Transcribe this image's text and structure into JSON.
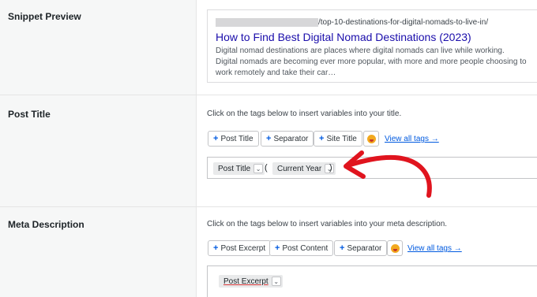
{
  "snippet_preview": {
    "label": "Snippet Preview",
    "url": "/top-10-destinations-for-digital-nomads-to-live-in/",
    "title": "How to Find Best Digital Nomad Destinations (2023)",
    "description": "Digital nomad destinations are places where digital nomads can live while working. Digital nomads are becoming ever more popular, with more and more people choosing to work remotely and take their car…"
  },
  "post_title": {
    "label": "Post Title",
    "help": "Click on the tags below to insert variables into your title.",
    "tags": [
      "Post Title",
      "Separator",
      "Site Title"
    ],
    "view_all": "View all tags →",
    "editor": {
      "token1": "Post Title",
      "open_paren": "(",
      "token2": "Current Year",
      "close_paren": ")"
    }
  },
  "meta_description": {
    "label": "Meta Description",
    "help": "Click on the tags below to insert variables into your meta description.",
    "tags": [
      "Post Excerpt",
      "Post Content",
      "Separator"
    ],
    "view_all": "View all tags →",
    "editor": {
      "token1": "Post Excerpt"
    }
  },
  "colors": {
    "link": "#005ae0",
    "snippet_title": "#1a0dab",
    "arrow": "#e0141e"
  }
}
